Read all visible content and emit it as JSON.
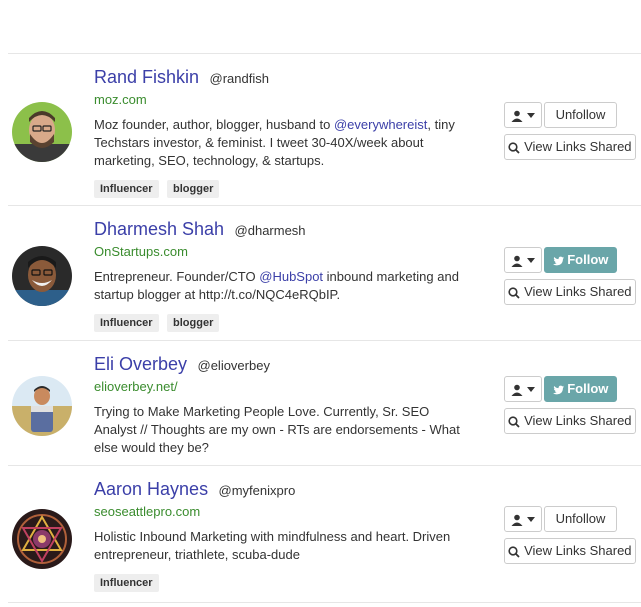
{
  "profiles": [
    {
      "name": "Rand Fishkin",
      "handle": "@randfish",
      "site": "moz.com",
      "bio_before": "Moz founder, author, blogger, husband to ",
      "bio_mention": "@everywhereist",
      "bio_after": ", tiny Techstars investor, & feminist. I tweet 30-40X/week about marketing, SEO, technology, & startups.",
      "tags": [
        "Influencer",
        "blogger"
      ],
      "action_label": "Unfollow",
      "action_state": "unfollow",
      "links_label": "View Links Shared"
    },
    {
      "name": "Dharmesh Shah",
      "handle": "@dharmesh",
      "site": "OnStartups.com",
      "bio_before": "Entrepreneur. Founder/CTO ",
      "bio_mention": "@HubSpot",
      "bio_after": " inbound marketing and startup blogger at http://t.co/NQC4eRQbIP.",
      "tags": [
        "Influencer",
        "blogger"
      ],
      "action_label": "Follow",
      "action_state": "follow",
      "links_label": "View Links Shared"
    },
    {
      "name": "Eli Overbey",
      "handle": "@elioverbey",
      "site": "elioverbey.net/",
      "bio_before": "Trying to Make Marketing People Love. Currently, Sr. SEO Analyst // Thoughts are my own - RTs are endorsements - What else would they be?",
      "bio_mention": "",
      "bio_after": "",
      "tags": [],
      "action_label": "Follow",
      "action_state": "follow",
      "links_label": "View Links Shared"
    },
    {
      "name": "Aaron Haynes",
      "handle": "@myfenixpro",
      "site": "seoseattlepro.com",
      "bio_before": "Holistic Inbound Marketing with mindfulness and heart. Driven entrepreneur, triathlete, scuba-dude",
      "bio_mention": "",
      "bio_after": "",
      "tags": [
        "Influencer"
      ],
      "action_label": "Unfollow",
      "action_state": "unfollow",
      "links_label": "View Links Shared"
    }
  ],
  "colors": {
    "name_link": "#3b3fa8",
    "site_link": "#3a8c2e",
    "follow_button": "#6aa6a9"
  },
  "icons": {
    "menu": "user-icon",
    "caret": "caret-down-icon",
    "links": "search-icon",
    "follow": "twitter-icon"
  }
}
